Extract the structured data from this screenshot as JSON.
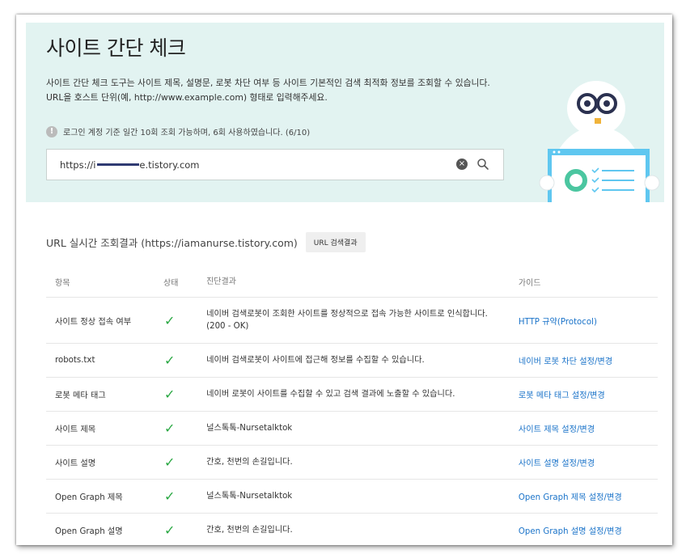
{
  "hero": {
    "title": "사이트 간단 체크",
    "desc_line1": "사이트 간단 체크 도구는 사이트 제목, 설명문, 로봇 차단 여부 등 사이트 기본적인 검색 최적화 정보를 조회할 수 있습니다.",
    "desc_line2": "URL을 호스트 단위(예, http://www.example.com) 형태로 입력해주세요.",
    "notice_icon": "!",
    "notice": "로그인 계정 기준 일간 10회 조회 가능하며, 6회 사용하였습니다. (6/10)"
  },
  "search": {
    "value_prefix": "https://i",
    "value_suffix": "e.tistory.com",
    "clear_icon": "×"
  },
  "result": {
    "title": "URL 실시간 조회결과 (https://iamanurse.tistory.com)",
    "button_label": "URL 검색결과"
  },
  "table": {
    "headers": [
      "항목",
      "상태",
      "진단결과",
      "가이드"
    ],
    "check_mark": "✓",
    "rows": [
      {
        "item": "사이트 정상 접속 여부",
        "result": "네이버 검색로봇이 조회한 사이트를 정상적으로 접속 가능한 사이트로 인식합니다. (200 - OK)",
        "guide": "HTTP 규약(Protocol)"
      },
      {
        "item": "robots.txt",
        "result": "네이버 검색로봇이 사이트에 접근해 정보를 수집할 수 있습니다.",
        "guide": "네이버 로봇 차단 설정/변경"
      },
      {
        "item": "로봇 메타 태그",
        "result": "네이버 로봇이 사이트를 수집할 수 있고 검색 결과에 노출할 수 있습니다.",
        "guide": "로봇 메타 태그 설정/변경"
      },
      {
        "item": "사이트 제목",
        "result": "널스톡톡-Nursetalktok",
        "guide": "사이트 제목 설정/변경"
      },
      {
        "item": "사이트 설명",
        "result": "간호, 천번의 손길입니다.",
        "guide": "사이트 설명 설정/변경"
      },
      {
        "item": "Open Graph 제목",
        "result": "널스톡톡-Nursetalktok",
        "guide": "Open Graph 제목 설정/변경"
      },
      {
        "item": "Open Graph 설명",
        "result": "간호, 천번의 손길입니다.",
        "guide": "Open Graph 설명 설정/변경"
      }
    ]
  },
  "colors": {
    "hero_bg": "#e2f3f1",
    "check": "#2aa843",
    "link": "#1a73c9"
  }
}
